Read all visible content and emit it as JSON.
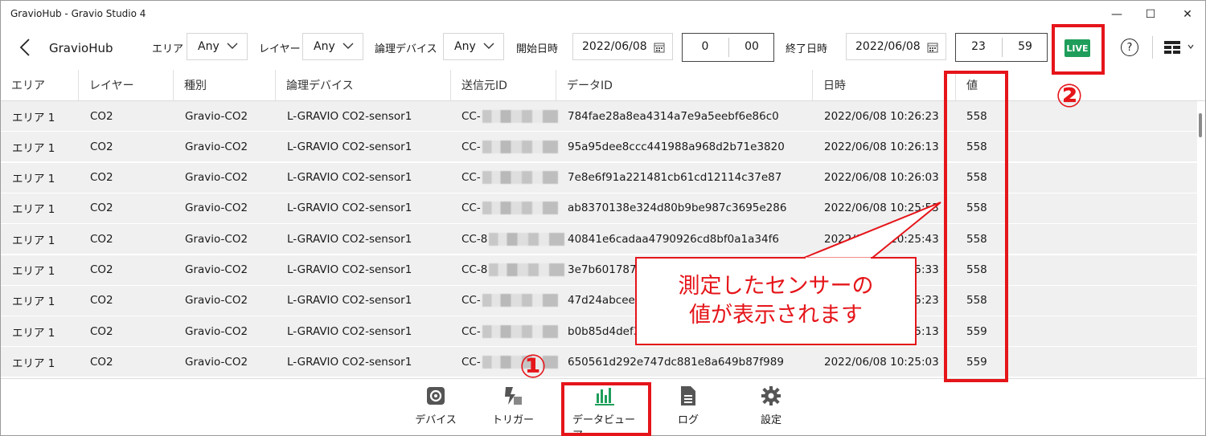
{
  "window": {
    "title": "GravioHub - Gravio Studio 4",
    "minimize_glyph": "—",
    "maximize_glyph": "☐",
    "close_glyph": "✕"
  },
  "toolbar": {
    "app_title": "GravioHub",
    "area_label": "エリア",
    "area_value": "Any",
    "layer_label": "レイヤー",
    "layer_value": "Any",
    "device_label": "論理デバイス",
    "device_value": "Any",
    "start_label": "開始日時",
    "start_date": "2022/06/08",
    "start_hour": "0",
    "start_minute": "00",
    "end_label": "終了日時",
    "end_date": "2022/06/08",
    "end_hour": "23",
    "end_minute": "59",
    "live_label": "LIVE",
    "help_glyph": "?"
  },
  "table": {
    "headers": [
      "エリア",
      "レイヤー",
      "種別",
      "論理デバイス",
      "送信元ID",
      "データID",
      "日時",
      "値"
    ],
    "rows": [
      {
        "area": "エリア 1",
        "layer": "CO2",
        "kind": "Gravio-CO2",
        "device": "L-GRAVIO CO2-sensor1",
        "sender": "CC-",
        "data_id": "784fae28a8ea4314a7e9a5eebf6e86c0",
        "datetime": "2022/06/08 10:26:23",
        "value": "558"
      },
      {
        "area": "エリア 1",
        "layer": "CO2",
        "kind": "Gravio-CO2",
        "device": "L-GRAVIO CO2-sensor1",
        "sender": "CC-",
        "data_id": "95a95dee8ccc441988a968d2b71e3820",
        "datetime": "2022/06/08 10:26:13",
        "value": "558"
      },
      {
        "area": "エリア 1",
        "layer": "CO2",
        "kind": "Gravio-CO2",
        "device": "L-GRAVIO CO2-sensor1",
        "sender": "CC-",
        "data_id": "7e8e6f91a221481cb61cd12114c37e87",
        "datetime": "2022/06/08 10:26:03",
        "value": "558"
      },
      {
        "area": "エリア 1",
        "layer": "CO2",
        "kind": "Gravio-CO2",
        "device": "L-GRAVIO CO2-sensor1",
        "sender": "CC-",
        "data_id": "ab8370138e324d80b9be987c3695e286",
        "datetime": "2022/06/08 10:25:53",
        "value": "558"
      },
      {
        "area": "エリア 1",
        "layer": "CO2",
        "kind": "Gravio-CO2",
        "device": "L-GRAVIO CO2-sensor1",
        "sender": "CC-8",
        "data_id": "40841e6cadaa4790926cd8bf0a1a34f6",
        "datetime": "2022/06/08 10:25:43",
        "value": "558"
      },
      {
        "area": "エリア 1",
        "layer": "CO2",
        "kind": "Gravio-CO2",
        "device": "L-GRAVIO CO2-sensor1",
        "sender": "CC-8",
        "data_id": "3e7b601787c",
        "datetime": "2022/06/08 10:25:33",
        "value": "558"
      },
      {
        "area": "エリア 1",
        "layer": "CO2",
        "kind": "Gravio-CO2",
        "device": "L-GRAVIO CO2-sensor1",
        "sender": "CC-",
        "data_id": "47d24abcee8",
        "datetime": "2022/06/08 10:25:23",
        "value": "558"
      },
      {
        "area": "エリア 1",
        "layer": "CO2",
        "kind": "Gravio-CO2",
        "device": "L-GRAVIO CO2-sensor1",
        "sender": "CC-",
        "data_id": "b0b85d4def3",
        "datetime": "2022/06/08 10:25:13",
        "value": "559"
      },
      {
        "area": "エリア 1",
        "layer": "CO2",
        "kind": "Gravio-CO2",
        "device": "L-GRAVIO CO2-sensor1",
        "sender": "CC-",
        "data_id": "650561d292e747dc881e8a649b87f989",
        "datetime": "2022/06/08 10:25:03",
        "value": "559"
      }
    ]
  },
  "nav": {
    "items": [
      {
        "label": "デバイス",
        "icon": "gear-chip-icon"
      },
      {
        "label": "トリガー",
        "icon": "trigger-icon"
      },
      {
        "label": "データビューア",
        "icon": "bar-chart-icon"
      },
      {
        "label": "ログ",
        "icon": "document-icon"
      },
      {
        "label": "設定",
        "icon": "gear-icon"
      }
    ],
    "active_index": 2
  },
  "annotations": {
    "marker_1": "①",
    "marker_2": "②",
    "callout_line1": "測定したセンサーの",
    "callout_line2": "値が表示されます",
    "color": "#e5151a"
  },
  "colors": {
    "live_green": "#1e9e5a",
    "row_bg": "#f0f0f0",
    "accent_nav": "#1e9e5a"
  }
}
